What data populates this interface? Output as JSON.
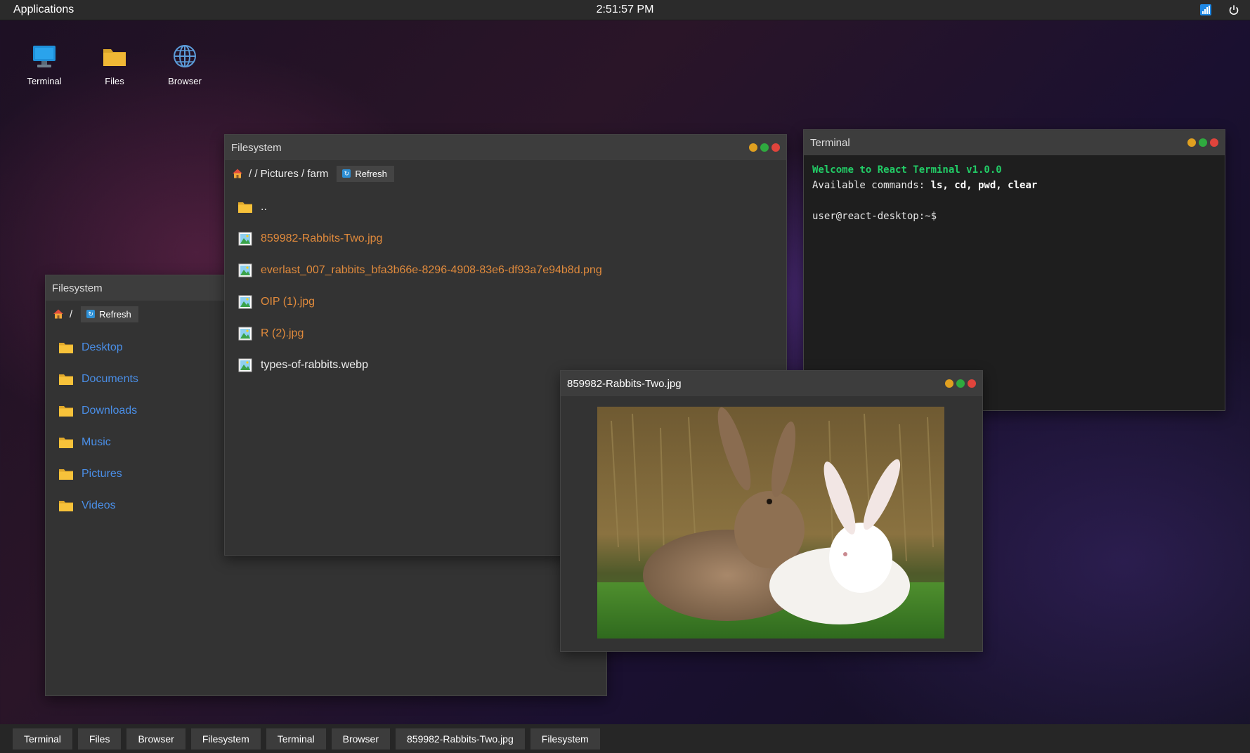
{
  "topbar": {
    "applications_label": "Applications",
    "clock": "2:51:57 PM",
    "tray_icons": [
      "network-icon",
      "power-icon"
    ]
  },
  "desktop_icons": [
    {
      "label": "Terminal",
      "icon": "monitor-icon"
    },
    {
      "label": "Files",
      "icon": "folder-icon"
    },
    {
      "label": "Browser",
      "icon": "globe-icon"
    }
  ],
  "filesystem_root": {
    "title": "Filesystem",
    "path": "/",
    "refresh_label": "Refresh",
    "items": [
      {
        "name": "Desktop",
        "type": "folder"
      },
      {
        "name": "Documents",
        "type": "folder"
      },
      {
        "name": "Downloads",
        "type": "folder"
      },
      {
        "name": "Music",
        "type": "folder"
      },
      {
        "name": "Pictures",
        "type": "folder"
      },
      {
        "name": "Videos",
        "type": "folder"
      }
    ]
  },
  "filesystem_farm": {
    "title": "Filesystem",
    "path": "/ / Pictures / farm",
    "refresh_label": "Refresh",
    "items": [
      {
        "name": "..",
        "type": "folder"
      },
      {
        "name": "859982-Rabbits-Two.jpg",
        "type": "image"
      },
      {
        "name": "everlast_007_rabbits_bfa3b66e-8296-4908-83e6-df93a7e94b8d.png",
        "type": "image"
      },
      {
        "name": "OIP (1).jpg",
        "type": "image"
      },
      {
        "name": "R (2).jpg",
        "type": "image"
      },
      {
        "name": "types-of-rabbits.webp",
        "type": "image"
      }
    ]
  },
  "terminal": {
    "title": "Terminal",
    "welcome": "Welcome to React Terminal v1.0.0",
    "available_prefix": "Available commands: ",
    "commands": "ls, cd, pwd, clear",
    "prompt": "user@react-desktop:~$"
  },
  "image_viewer": {
    "title": "859982-Rabbits-Two.jpg"
  },
  "taskbar": {
    "items": [
      "Terminal",
      "Files",
      "Browser",
      "Filesystem",
      "Terminal",
      "Browser",
      "859982-Rabbits-Two.jpg",
      "Filesystem"
    ]
  },
  "colors": {
    "folder_link": "#4a8fe8",
    "image_link": "#e08a3c",
    "terminal_green": "#22cc66"
  }
}
